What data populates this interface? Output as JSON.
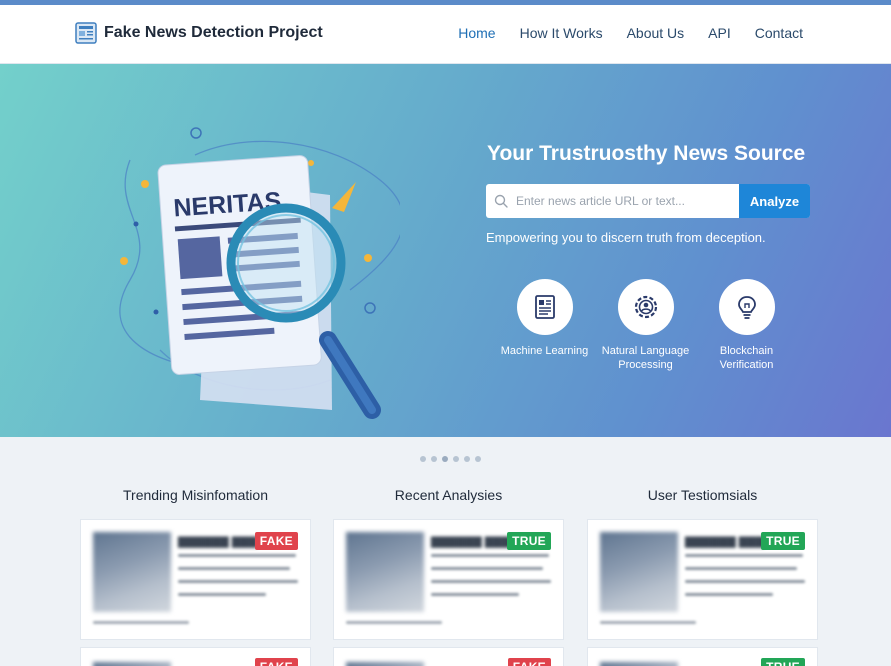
{
  "app": {
    "title": "Fake News Detection Project"
  },
  "nav": {
    "items": [
      {
        "label": "Home",
        "active": true
      },
      {
        "label": "How It Works",
        "active": false
      },
      {
        "label": "About Us",
        "active": false
      },
      {
        "label": "API",
        "active": false
      },
      {
        "label": "Contact",
        "active": false
      }
    ]
  },
  "hero": {
    "newspaper_name": "NERITAS",
    "title": "Your Trustruosthy News Source",
    "search_placeholder": "Enter news article URL or text...",
    "search_button": "Analyze",
    "tagline": "Empowering you to discern truth from deception.",
    "features": [
      {
        "icon": "document-icon",
        "label_line1": "Machine Learning",
        "label_line2": ""
      },
      {
        "icon": "brain-gear-icon",
        "label_line1": "Natural Language",
        "label_line2": "Processing"
      },
      {
        "icon": "lightbulb-icon",
        "label_line1": "Blockchain",
        "label_line2": "Verification"
      }
    ]
  },
  "carousel": {
    "dot_count": 6,
    "active_index": 2
  },
  "sections": [
    {
      "title": "Trending Misinfomation",
      "badges": [
        "FAKE",
        "FAKE"
      ]
    },
    {
      "title": "Recent Analysies",
      "badges": [
        "TRUE",
        "FAKE"
      ]
    },
    {
      "title": "User Testiomsials",
      "badges": [
        "TRUE",
        "TRUE"
      ]
    }
  ],
  "colors": {
    "accent": "#1e86d8",
    "fake": "#e0434c",
    "true": "#22a657",
    "nav_text": "#2b4a6b"
  }
}
